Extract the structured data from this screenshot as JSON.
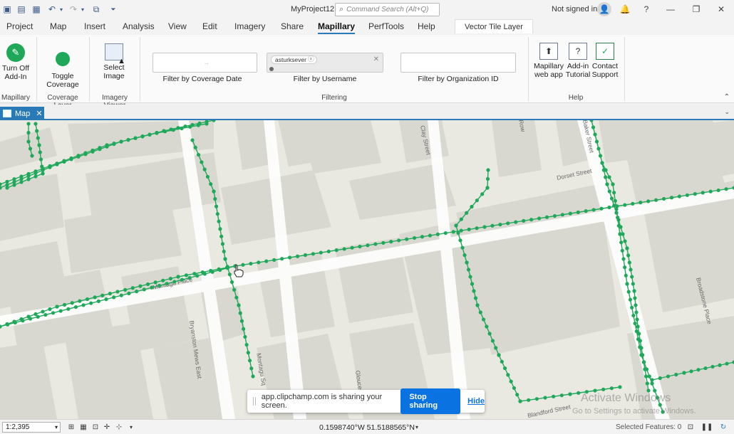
{
  "app": {
    "title": "MyProject12",
    "command_search_placeholder": "Command Search (Alt+Q)",
    "user_status": "Not signed in",
    "window_controls": [
      "minimize-icon",
      "restore-icon",
      "close-icon"
    ]
  },
  "tabs": [
    "Project",
    "Map",
    "Insert",
    "Analysis",
    "View",
    "Edit",
    "Imagery",
    "Share",
    "Mapillary",
    "PerfTools",
    "Help"
  ],
  "active_tab": "Mapillary",
  "contextual_tab": "Vector Tile Layer",
  "ribbon": {
    "mapillary_group": {
      "label": "Mapillary",
      "button": "Turn Off Add-In",
      "button_line1": "Turn Off",
      "button_line2": "Add-In"
    },
    "coverage_group": {
      "label": "Coverage Layer",
      "button_line1": "Toggle",
      "button_line2": "Coverage"
    },
    "imagery_group": {
      "label": "Imagery Viewer",
      "button_line1": "Select",
      "button_line2": "Image"
    },
    "filtering": {
      "label": "Filtering",
      "coverage_date_label": "Filter by Coverage Date",
      "coverage_date_value": "",
      "username_label": "Filter by Username",
      "username_chip": "asturksever",
      "org_label": "Filter by Organization ID",
      "org_value": ""
    },
    "help_group": {
      "label": "Help",
      "web_app": [
        "Mapillary",
        "web app"
      ],
      "tutorial": [
        "Add-in",
        "Tutorial"
      ],
      "support": [
        "Contact",
        "Support"
      ]
    }
  },
  "map_view": {
    "tab_label": "Map",
    "street_labels": [
      "Dorset Street",
      "Montagu Place",
      "Clay Street",
      "Bryanston Mews East",
      "Blandford Street",
      "Broadstone Place",
      "Baker Street",
      "Row",
      "Montagu Sq",
      "Gloucester"
    ],
    "coverage_color": "#1fa85a",
    "background_color": "#e9e8e1",
    "building_color": "#d9d8d0"
  },
  "share_bar": {
    "message": "app.clipchamp.com is sharing your screen.",
    "stop_label": "Stop sharing",
    "hide_label": "Hide"
  },
  "watermark": {
    "line1": "Activate Windows",
    "line2": "Go to Settings to activate Windows."
  },
  "status_bar": {
    "scale": "1:2,395",
    "coordinates": "0.1598740°W 51.5188565°N",
    "selected_features": "Selected Features: 0"
  }
}
